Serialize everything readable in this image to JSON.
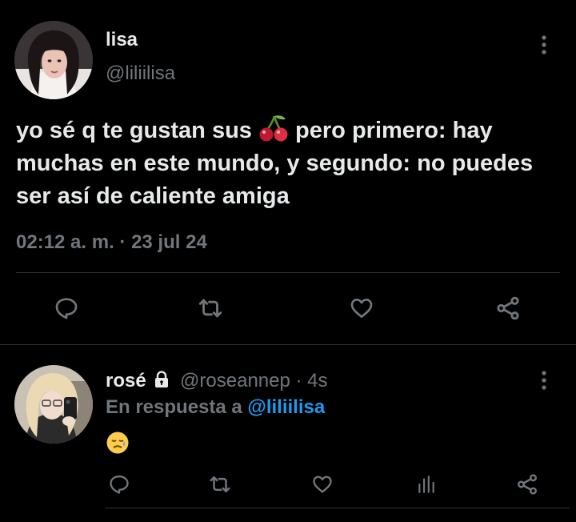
{
  "main_tweet": {
    "display_name": "lisa",
    "handle": "@liliilisa",
    "text_before_emoji": "yo sé q te gustan sus",
    "emoji": "cherries",
    "text_after_emoji": "pero primero: hay muchas en este mundo, y segundo: no puedes ser así de caliente amiga",
    "timestamp": "02:12 a. m. · 23 jul 24"
  },
  "actions": {
    "reply": "reply-icon",
    "retweet": "retweet-icon",
    "like": "heart-icon",
    "share": "share-icon",
    "analytics": "analytics-icon",
    "more": "more-vertical-icon"
  },
  "reply_tweet": {
    "display_name": "rosé",
    "lock_icon": "lock-icon",
    "handle": "@roseannep",
    "time": "· 4s",
    "in_reply_prefix": "En respuesta a",
    "in_reply_handle": "@liliilisa",
    "emoji": "sad-relieved-face"
  },
  "colors": {
    "background": "#000000",
    "text": "#e7e9ea",
    "muted": "#71767b",
    "link": "#1d9bf0",
    "divider": "#2f3336"
  }
}
